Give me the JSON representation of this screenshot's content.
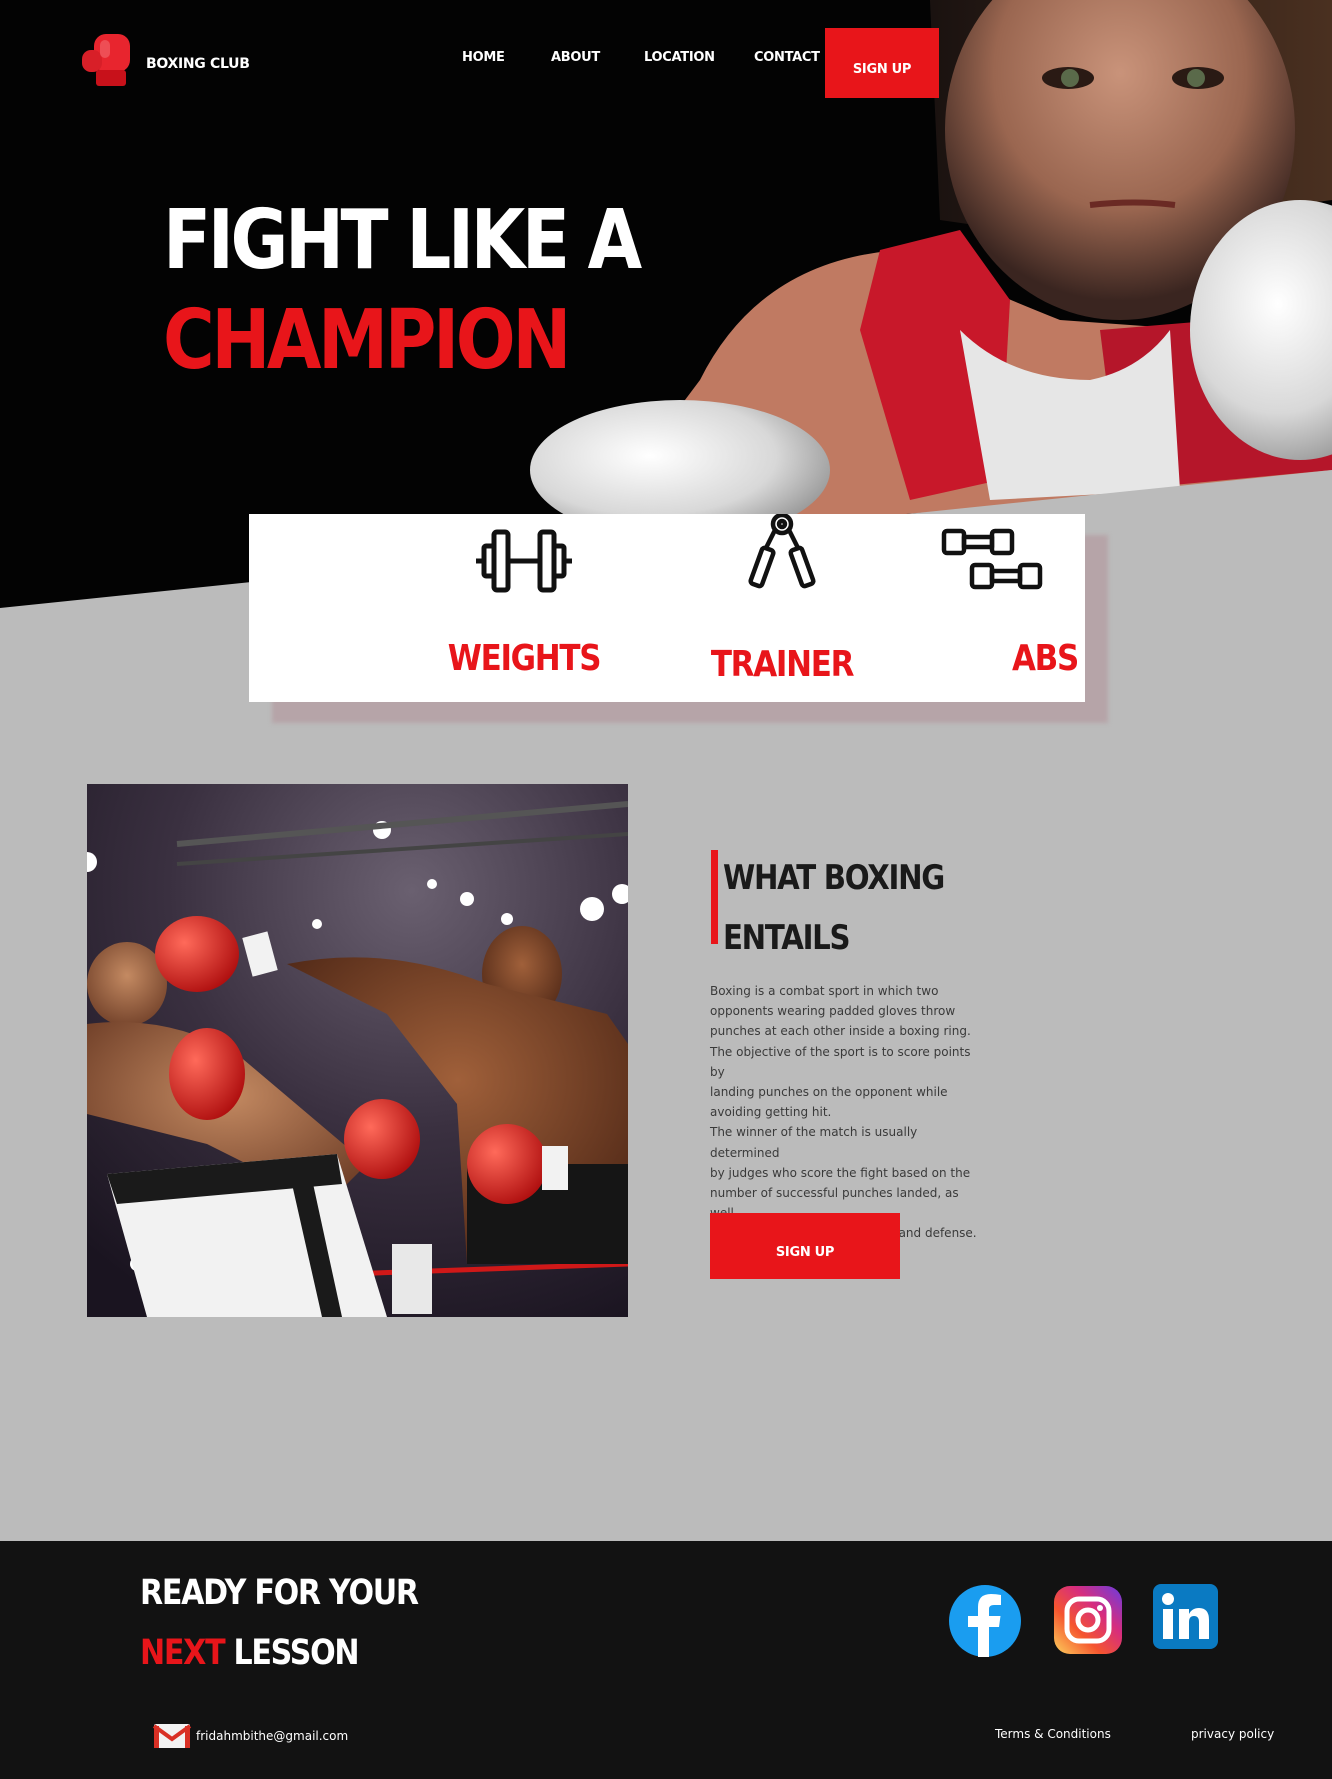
{
  "brand": {
    "name": "BOXING CLUB"
  },
  "nav": {
    "items": [
      {
        "label": "HOME"
      },
      {
        "label": "ABOUT"
      },
      {
        "label": "LOCATION"
      },
      {
        "label": "CONTACT"
      }
    ],
    "signup_label": "SIGN UP"
  },
  "hero": {
    "title_line1": "FIGHT LIKE A",
    "title_line2": "CHAMPION"
  },
  "features": [
    {
      "label": "WEIGHTS",
      "icon": "barbell-icon"
    },
    {
      "label": "TRAINER",
      "icon": "hand-gripper-icon"
    },
    {
      "label": "ABS",
      "icon": "dumbbells-icon"
    }
  ],
  "about": {
    "title_line1": "WHAT BOXING",
    "title_line2": "ENTAILS",
    "body_lines": [
      "Boxing is a combat sport in which two",
      "opponents wearing padded gloves throw",
      "punches at each other inside a boxing ring.",
      "The objective of the sport is to score points by",
      "landing punches on the opponent while",
      "avoiding getting hit.",
      "The winner of the match is usually determined",
      "by judges who score the fight based on the",
      "number of successful punches landed, as well",
      "as factors like ring generalship and defense."
    ],
    "signup_label": "SIGN UP"
  },
  "footer": {
    "title_line1": "READY FOR YOUR",
    "title_red": "NEXT",
    "title_rest": " LESSON",
    "email": "fridahmbithe@gmail.com",
    "terms_label": "Terms & Conditions",
    "privacy_label": "privacy policy",
    "social": [
      "facebook-icon",
      "instagram-icon",
      "linkedin-icon"
    ]
  },
  "colors": {
    "accent": "#e8151a",
    "dark": "#121212",
    "page_bg": "#bbbbbb"
  }
}
